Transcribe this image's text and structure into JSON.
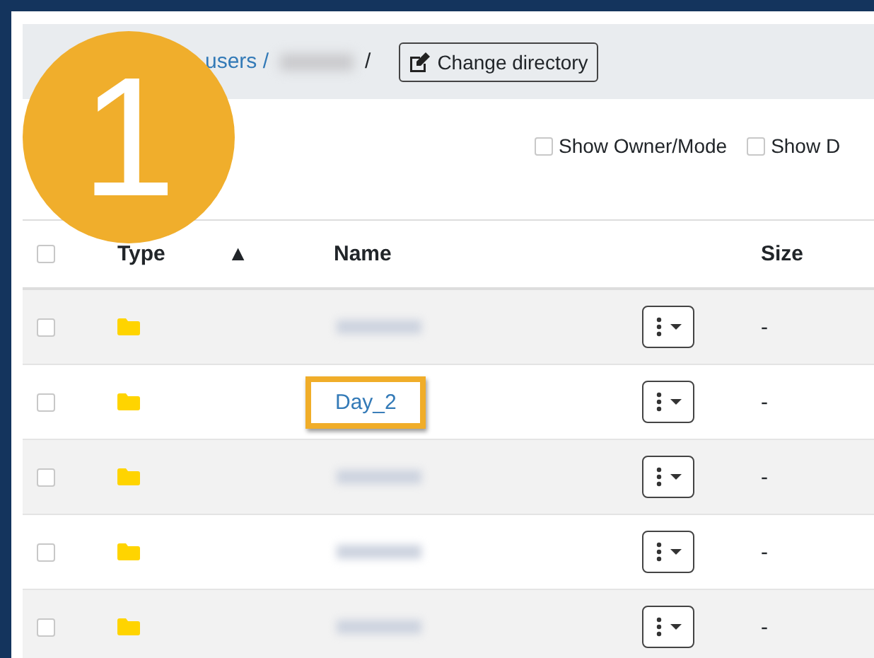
{
  "step_badge": "1",
  "breadcrumb": {
    "link": "users /",
    "separator": "/",
    "button": "Change directory"
  },
  "options": [
    {
      "label": "Show Owner/Mode",
      "checked": false
    },
    {
      "label": "Show D",
      "checked": false
    }
  ],
  "table": {
    "select_all": false,
    "columns": [
      {
        "label": "Type",
        "sort_indicator": "▲"
      },
      {
        "label": "Name"
      },
      {
        "label": "Size"
      }
    ],
    "rows": [
      {
        "kind": "blurred",
        "highlighted": false,
        "size": "-",
        "checked": false
      },
      {
        "kind": "link",
        "name": "Day_2",
        "highlighted": true,
        "size": "-",
        "checked": false
      },
      {
        "kind": "blurred",
        "highlighted": false,
        "size": "-",
        "checked": false
      },
      {
        "kind": "blurred",
        "highlighted": false,
        "size": "-",
        "checked": false
      },
      {
        "kind": "blurred",
        "highlighted": false,
        "size": "-",
        "checked": false
      }
    ]
  }
}
